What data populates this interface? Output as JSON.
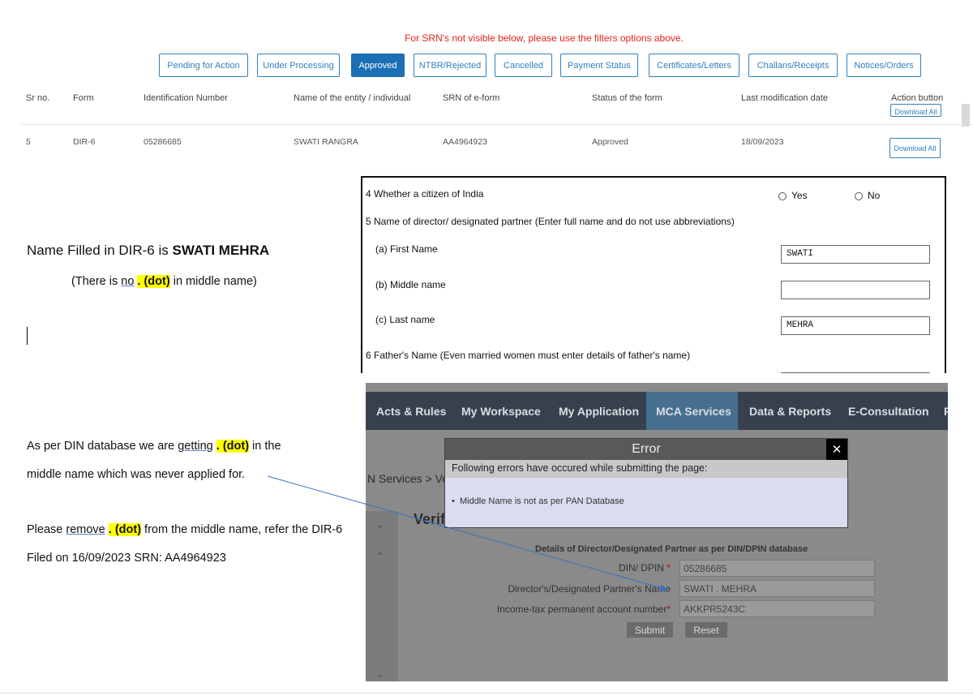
{
  "srn": {
    "notice": "For SRN's not visible below, please use the filters options above.",
    "tabs": [
      "Pending for Action",
      "Under Processing",
      "Approved",
      "NTBR/Rejected",
      "Cancelled",
      "Payment Status",
      "Certificates/Letters",
      "Challans/Receipts",
      "Notices/Orders"
    ],
    "active_tab": "Approved",
    "columns": [
      "Sr no.",
      "Form",
      "Identification Number",
      "Name of the entity / individual",
      "SRN of e-form",
      "Status of the form",
      "Last modification date",
      "Action button"
    ],
    "row": {
      "sr_no": "5",
      "form": "DIR-6",
      "id_number": "05286685",
      "name": "SWATI RANGRA",
      "srn": "AA4964923",
      "status": "Approved",
      "date": "18/09/2023",
      "action": "Download All"
    },
    "cut_button": "Download All"
  },
  "notes": {
    "line1_prefix": "Name Filled in DIR-6 is ",
    "line1_name": "SWATI MEHRA",
    "line2_pre": "(There is ",
    "line2_no": "no",
    "line2_dot": ". (dot)",
    "line2_post": " in middle name)",
    "line3_pre": "As per DIN database we are ",
    "line3_getting": "getting",
    "line3_dot": ". (dot)",
    "line3_post": " in the",
    "line4": "middle name which was never applied for.",
    "line5_pre": "Please ",
    "line5_remove": "remove",
    "line5_dot": ". (dot)",
    "line5_post": " from the middle name, refer the DIR-6",
    "line6": "Filed on 16/09/2023 SRN: AA4964923"
  },
  "form": {
    "q4": "4 Whether a citizen of India",
    "yes": "Yes",
    "no": "No",
    "q5": "5 Name of director/ designated partner (Enter full name and do not use abbreviations)",
    "first_label": "(a) First Name",
    "first_value": "SWATI",
    "middle_label": "(b) Middle name",
    "middle_value": "",
    "last_label": "(c) Last name",
    "last_value": "MEHRA",
    "q6": "6 Father's Name (Even married women must enter details of father's name)"
  },
  "mca": {
    "nav": [
      "Acts & Rules",
      "My Workspace",
      "My Application",
      "MCA Services",
      "Data & Reports",
      "E-Consultation",
      "F"
    ],
    "active_nav": "MCA Services",
    "breadcrumb": "N Services > Ve",
    "heading": "Verif",
    "error_title": "Error",
    "error_close": "✕",
    "error_sub": "Following errors have occured while submitting the page:",
    "error_msg": "Middle Name is not as per PAN Database",
    "details_title": "Details of Director/Designated Partner as per DIN/DPIN database",
    "din_label": "DIN/ DPIN",
    "din_value": "05286685",
    "name_label": "Director's/Designated Partner's Name",
    "name_value": "SWATI . MEHRA",
    "pan_label": "Income-tax permanent account number",
    "pan_value": "AKKPR5243C",
    "submit": "Submit",
    "reset": "Reset",
    "req_mark": "*"
  },
  "colors": {
    "accent_blue": "#1b6fb5",
    "notice_red": "#e2231a",
    "highlight": "#ffff00",
    "nav_bg": "#37414d",
    "arrow": "#3a6fc4"
  }
}
